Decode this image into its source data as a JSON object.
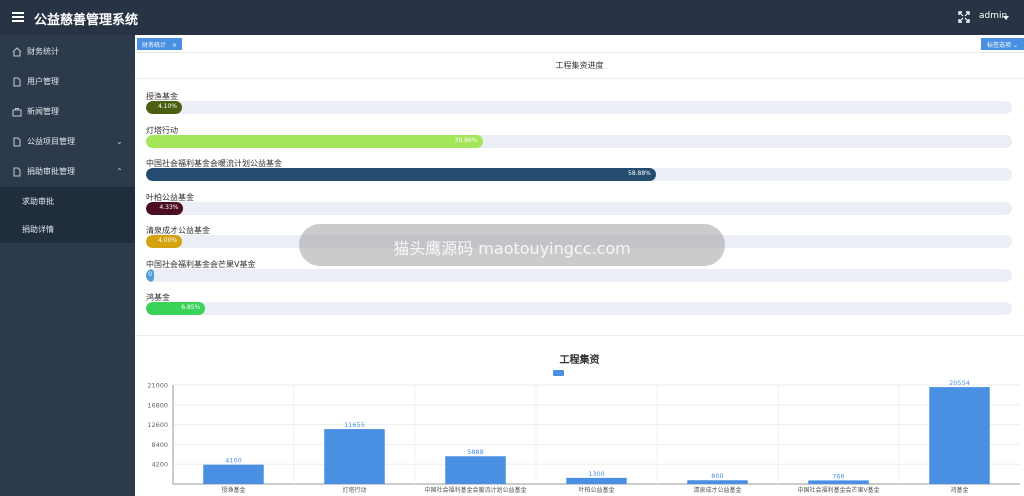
{
  "header": {
    "title": "公益慈善管理系统",
    "user": "admin"
  },
  "sidebar": {
    "items": [
      {
        "label": "财务统计",
        "icon": "home-icon"
      },
      {
        "label": "用户管理",
        "icon": "document-icon"
      },
      {
        "label": "新闻管理",
        "icon": "briefcase-icon"
      },
      {
        "label": "公益项目管理",
        "icon": "document-icon"
      },
      {
        "label": "捐助审批管理",
        "icon": "document-icon"
      }
    ],
    "sub_items": [
      {
        "label": "求助审批"
      },
      {
        "label": "捐助详情"
      }
    ]
  },
  "tabs": {
    "active_tab": "财务统计",
    "close": "×",
    "options": "标签选项"
  },
  "progress": {
    "title": "工程集资进度",
    "items": [
      {
        "label": "授渔基金",
        "percent": 4.1,
        "text": "4.10%",
        "color": "#4a5f12"
      },
      {
        "label": "灯塔行动",
        "percent": 38.86,
        "text": "38.86%",
        "color": "#a3e65a"
      },
      {
        "label": "中国社会福利基金会暖流计划公益基金",
        "percent": 58.88,
        "text": "58.88%",
        "color": "#244c6e"
      },
      {
        "label": "叶柏公益基金",
        "percent": 4.33,
        "text": "4.33%",
        "color": "#4d0d21"
      },
      {
        "label": "清泉成才公益基金",
        "percent": 4.0,
        "text": "4.00%",
        "color": "#d4a30f"
      },
      {
        "label": "中国社会福利基金会芒果V基金",
        "percent": 0.9,
        "text": "0",
        "color": "#4a9fd8"
      },
      {
        "label": "鸿基金",
        "percent": 6.85,
        "text": "6.85%",
        "color": "#3ad35a"
      }
    ]
  },
  "watermark": "猫头鹰源码 maotouyingcc.com",
  "chart_data": {
    "type": "bar",
    "title": "工程集资",
    "categories": [
      "授渔基金",
      "灯塔行动",
      "中国社会福利基金会暖流计划公益基金",
      "叶柏公益基金",
      "清泉成才公益基金",
      "中国社会福利基金会芒果V基金",
      "鸿基金"
    ],
    "values": [
      4100,
      11655,
      5888,
      1300,
      800,
      766,
      20554
    ],
    "y_ticks": [
      4200,
      8400,
      12600,
      16800,
      21000
    ],
    "ylim": [
      0,
      21000
    ],
    "color": "#4a90e2",
    "grid": true
  }
}
